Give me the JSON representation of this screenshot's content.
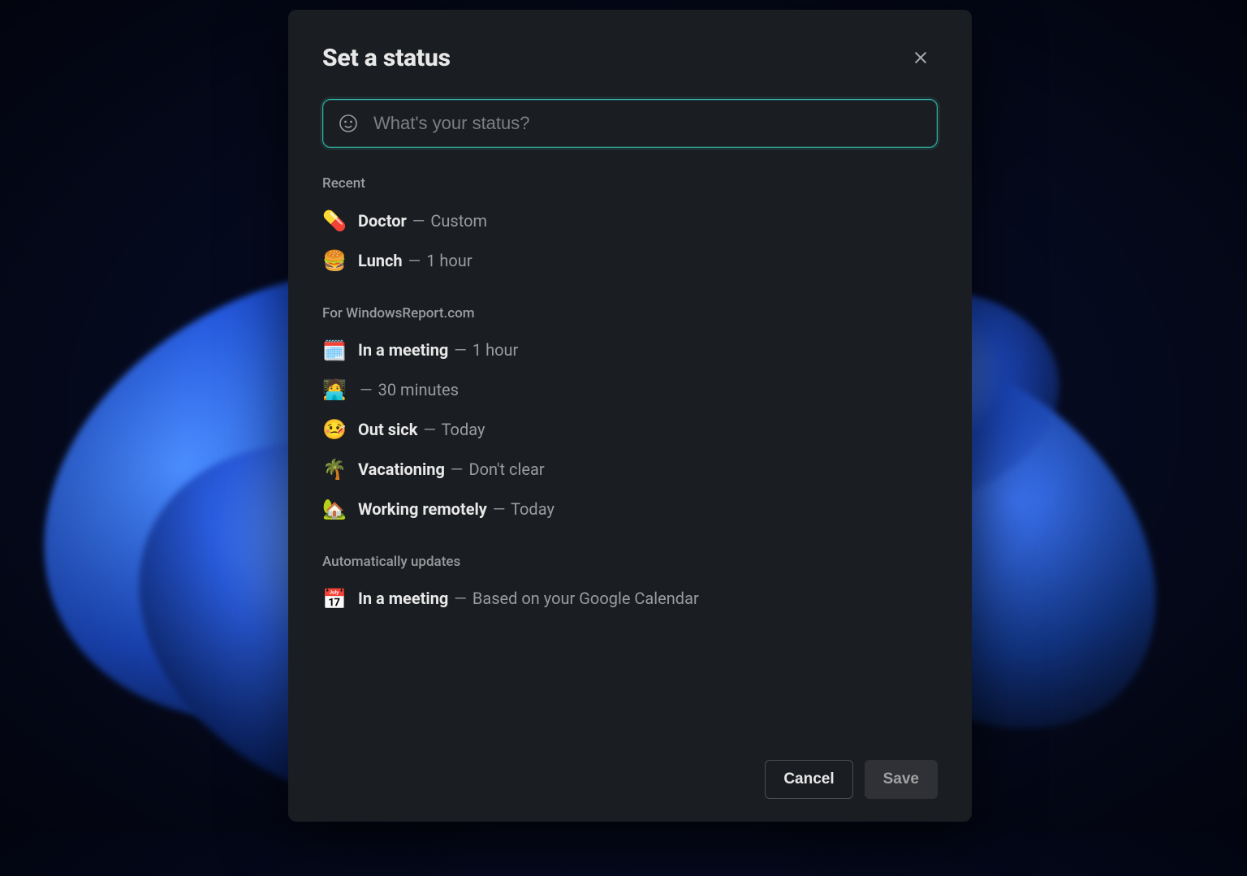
{
  "modal": {
    "title": "Set a status",
    "input_placeholder": "What's your status?",
    "sections": [
      {
        "heading": "Recent",
        "items": [
          {
            "emoji": "💊",
            "label": "Doctor",
            "duration": "Custom"
          },
          {
            "emoji": "🍔",
            "label": "Lunch",
            "duration": "1 hour"
          }
        ]
      },
      {
        "heading": "For WindowsReport.com",
        "items": [
          {
            "emoji": "🗓️",
            "label": "In a meeting",
            "duration": "1 hour"
          },
          {
            "emoji": "🧑‍💻",
            "label": "",
            "duration": "30 minutes"
          },
          {
            "emoji": "🤒",
            "label": "Out sick",
            "duration": "Today"
          },
          {
            "emoji": "🌴",
            "label": "Vacationing",
            "duration": "Don't clear"
          },
          {
            "emoji": "🏡",
            "label": "Working remotely",
            "duration": "Today"
          }
        ]
      },
      {
        "heading": "Automatically updates",
        "items": [
          {
            "emoji": "📅",
            "label": "In a meeting",
            "duration": "Based on your Google Calendar"
          }
        ]
      }
    ],
    "buttons": {
      "cancel": "Cancel",
      "save": "Save"
    }
  },
  "separator": "—"
}
